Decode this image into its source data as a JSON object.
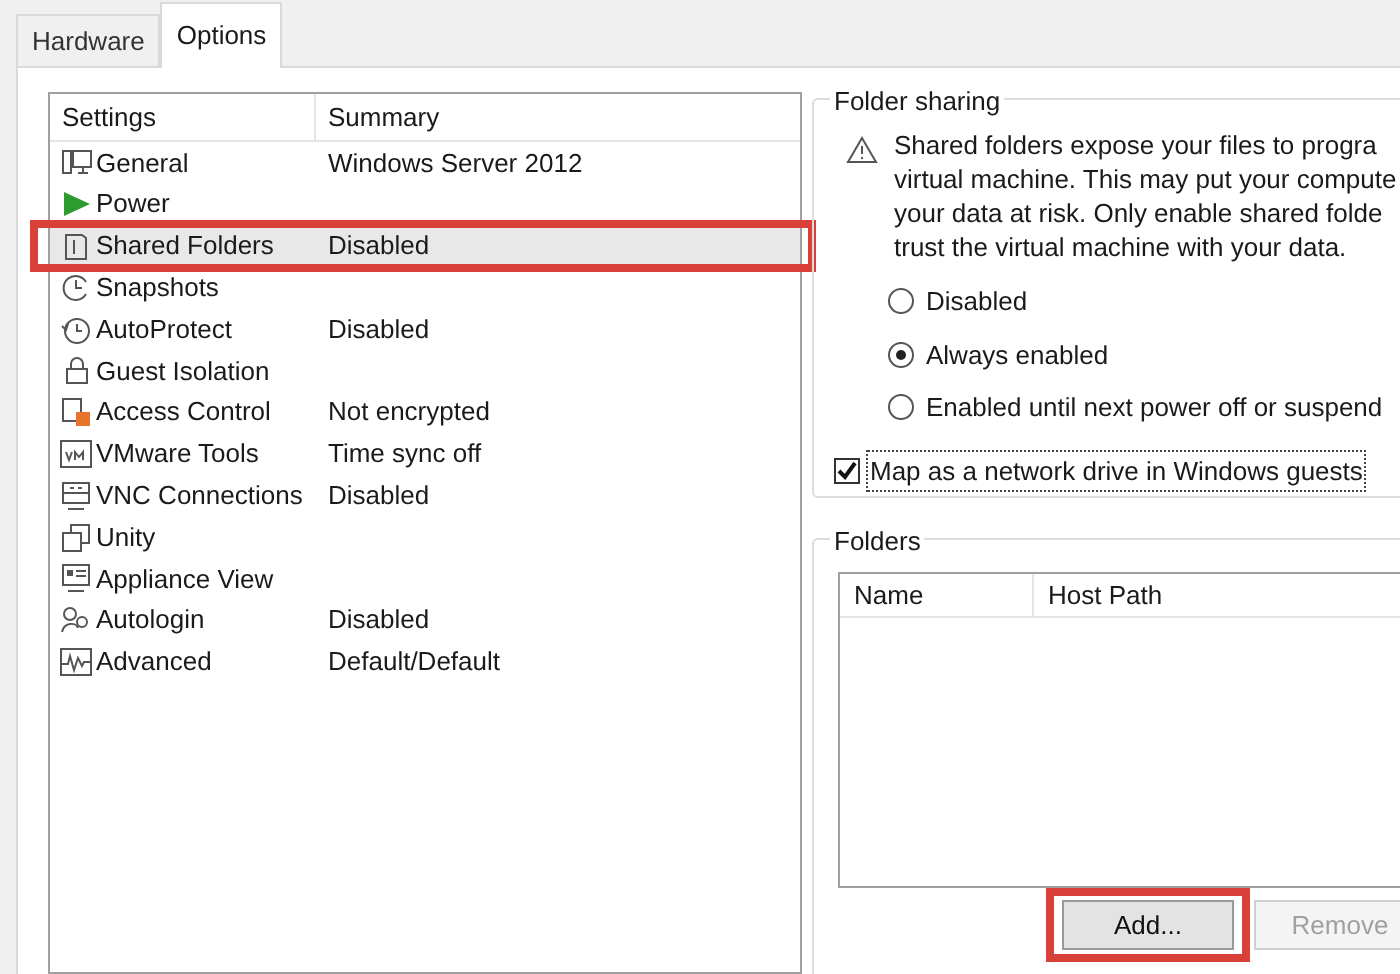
{
  "tabs": [
    {
      "label": "Hardware",
      "selected": false
    },
    {
      "label": "Options",
      "selected": true
    }
  ],
  "settings": {
    "columns": [
      "Settings",
      "Summary"
    ],
    "rows": [
      {
        "name": "General",
        "summary": "Windows Server 2012",
        "selected": false,
        "highlighted": false
      },
      {
        "name": "Power",
        "selected": false,
        "highlighted": false
      },
      {
        "name": "Shared Folders",
        "summary": "Disabled",
        "selected": true,
        "highlighted": true
      },
      {
        "name": "Snapshots",
        "selected": false,
        "highlighted": false
      },
      {
        "name": "AutoProtect",
        "summary": "Disabled",
        "selected": false,
        "highlighted": false
      },
      {
        "name": "Guest Isolation",
        "selected": false,
        "highlighted": false
      },
      {
        "name": "Access Control",
        "summary": "Not encrypted",
        "selected": false,
        "highlighted": false
      },
      {
        "name": "VMware Tools",
        "summary": "Time sync off",
        "selected": false,
        "highlighted": false
      },
      {
        "name": "VNC Connections",
        "summary": "Disabled",
        "selected": false,
        "highlighted": false
      },
      {
        "name": "Unity",
        "selected": false,
        "highlighted": false
      },
      {
        "name": "Appliance View",
        "selected": false,
        "highlighted": false
      },
      {
        "name": "Autologin",
        "summary": "Disabled",
        "selected": false,
        "highlighted": false
      },
      {
        "name": "Advanced",
        "summary": "Default/Default",
        "selected": false,
        "highlighted": false
      }
    ]
  },
  "folder_sharing": {
    "title": "Folder sharing",
    "warning_lines": [
      "Shared folders expose your files to progra",
      "virtual machine. This may put your compute",
      "your data at risk. Only enable shared folde",
      "trust the virtual machine with your data."
    ],
    "options": [
      {
        "label": "Disabled",
        "selected": false
      },
      {
        "label": "Always enabled",
        "selected": true
      },
      {
        "label": "Enabled until next power off or suspend",
        "selected": false
      }
    ],
    "map_drive": {
      "label": "Map as a network drive in Windows guests",
      "checked": true
    }
  },
  "folders": {
    "title": "Folders",
    "columns": [
      "Name",
      "Host Path"
    ],
    "buttons": [
      {
        "label": "Add...",
        "disabled": false,
        "highlighted": true
      },
      {
        "label": "Remove",
        "disabled": true,
        "highlighted": false
      }
    ]
  }
}
